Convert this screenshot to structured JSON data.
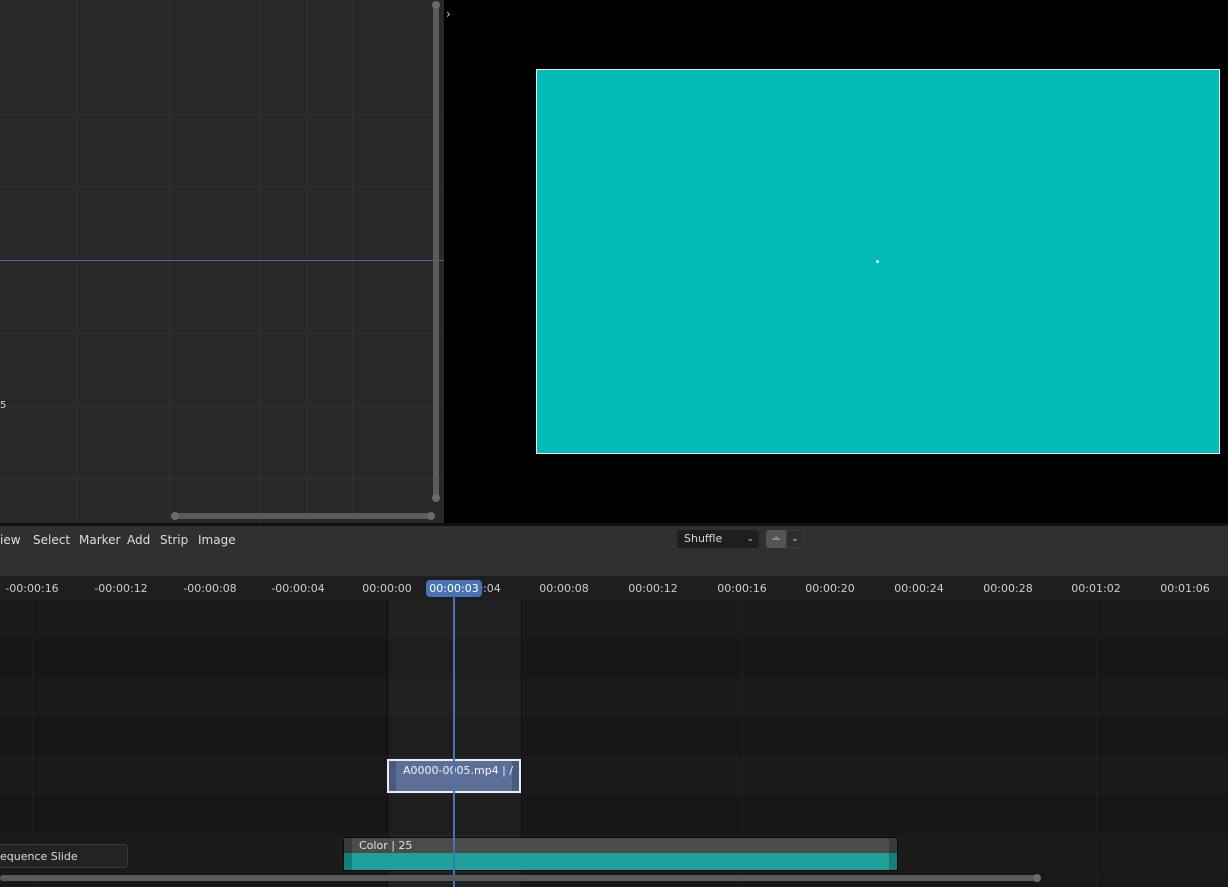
{
  "graph_editor": {
    "y_labels": [
      "",
      "5"
    ]
  },
  "preview": {
    "toggle_icon": "chevron-right-icon",
    "image_color": "#02bbb6"
  },
  "sequencer_header": {
    "menus": [
      "iew",
      "Select",
      "Marker",
      "Add",
      "Strip",
      "Image"
    ],
    "overlap_mode": {
      "selected": "Shuffle"
    },
    "snap_icon": "magnet-icon"
  },
  "timeline": {
    "ruler_ticks": [
      "-00:00:16",
      "-00:00:12",
      "-00:00:08",
      "-00:00:04",
      "00:00:00",
      "00:00:04",
      "00:00:08",
      "00:00:12",
      "00:00:16",
      "00:00:20",
      "00:00:24",
      "00:00:28",
      "00:01:02",
      "00:01:06"
    ],
    "current_time": "00:00:03",
    "strips": {
      "movie": {
        "label": "A0000-0005.mp4 | /",
        "color": "#5c6f99"
      },
      "color": {
        "label": "Color | 25",
        "color": "#1ea09b"
      }
    },
    "accent_color": "#4772b3"
  },
  "operator_panel": {
    "label": "equence Slide"
  }
}
